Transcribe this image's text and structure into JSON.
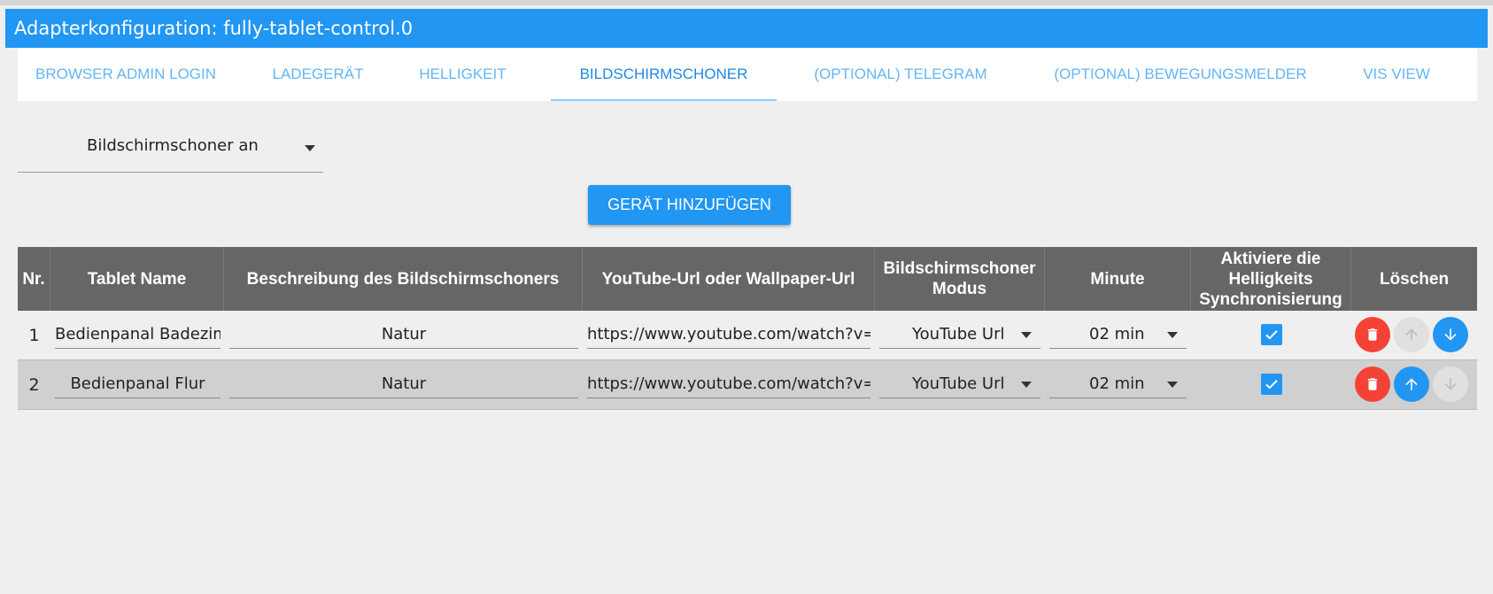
{
  "window": {
    "title": "Adapterkonfiguration: fully-tablet-control.0"
  },
  "tabs": [
    {
      "label": "BROWSER ADMIN LOGIN",
      "active": false
    },
    {
      "label": "LADEGERÄT",
      "active": false
    },
    {
      "label": "HELLIGKEIT",
      "active": false
    },
    {
      "label": "BILDSCHIRMSCHONER",
      "active": true
    },
    {
      "label": "(OPTIONAL) TELEGRAM",
      "active": false
    },
    {
      "label": "(OPTIONAL) BEWEGUNGSMELDER",
      "active": false
    },
    {
      "label": "VIS VIEW",
      "active": false
    }
  ],
  "screensaver_select": {
    "value": "Bildschirmschoner an"
  },
  "add_button": {
    "label": "GERÄT HINZUFÜGEN"
  },
  "table": {
    "headers": {
      "nr": "Nr.",
      "tablet_name": "Tablet Name",
      "description": "Beschreibung des Bildschirmschoners",
      "url": "YouTube-Url oder Wallpaper-Url",
      "mode_line1": "Bildschirmschoner",
      "mode_line2": "Modus",
      "minute": "Minute",
      "sync_line1": "Aktiviere die",
      "sync_line2": "Helligkeits",
      "sync_line3": "Synchronisierung",
      "delete": "Löschen"
    },
    "rows": [
      {
        "nr": "1",
        "tablet_name": "Bedienpanal Badezim",
        "description": "Natur",
        "url": "https://www.youtube.com/watch?v=",
        "mode": "YouTube Url",
        "minute": "02 min",
        "sync_checked": true,
        "up_enabled": false,
        "down_enabled": true
      },
      {
        "nr": "2",
        "tablet_name": "Bedienpanal Flur",
        "description": "Natur",
        "url": "https://www.youtube.com/watch?v=",
        "mode": "YouTube Url",
        "minute": "02 min",
        "sync_checked": true,
        "up_enabled": true,
        "down_enabled": false
      }
    ]
  },
  "colors": {
    "primary": "#2196f3",
    "danger": "#f44336",
    "header_bg": "#666666",
    "disabled": "#e0e0e0"
  },
  "icons": {
    "delete": "trash-icon",
    "move_up": "arrow-up-icon",
    "move_down": "arrow-down-icon",
    "checkbox": "check-icon",
    "dropdown": "caret-down-icon"
  }
}
